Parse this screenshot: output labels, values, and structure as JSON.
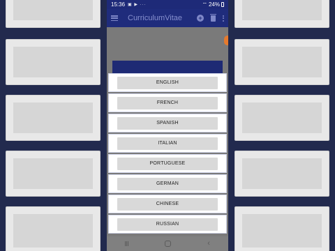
{
  "status_bar": {
    "time": "15:36",
    "icons": "▣ ▶ ···",
    "signal": "⌔",
    "battery": "24%"
  },
  "app_bar": {
    "title": "CurriculumVitae",
    "add_icon": "+"
  },
  "languages": [
    {
      "label": "ENGLISH"
    },
    {
      "label": "FRENCH"
    },
    {
      "label": "SPANISH"
    },
    {
      "label": "ITALIAN"
    },
    {
      "label": "PORTUGUESE"
    },
    {
      "label": "GERMAN"
    },
    {
      "label": "CHINESE"
    },
    {
      "label": "RUSSIAN"
    }
  ],
  "nav_bar": {
    "back": "‹"
  },
  "colors": {
    "app_bar": "#1f2c7c",
    "frame": "#2f3a85",
    "button": "#d9d9d9",
    "fab": "#e57a2e"
  }
}
